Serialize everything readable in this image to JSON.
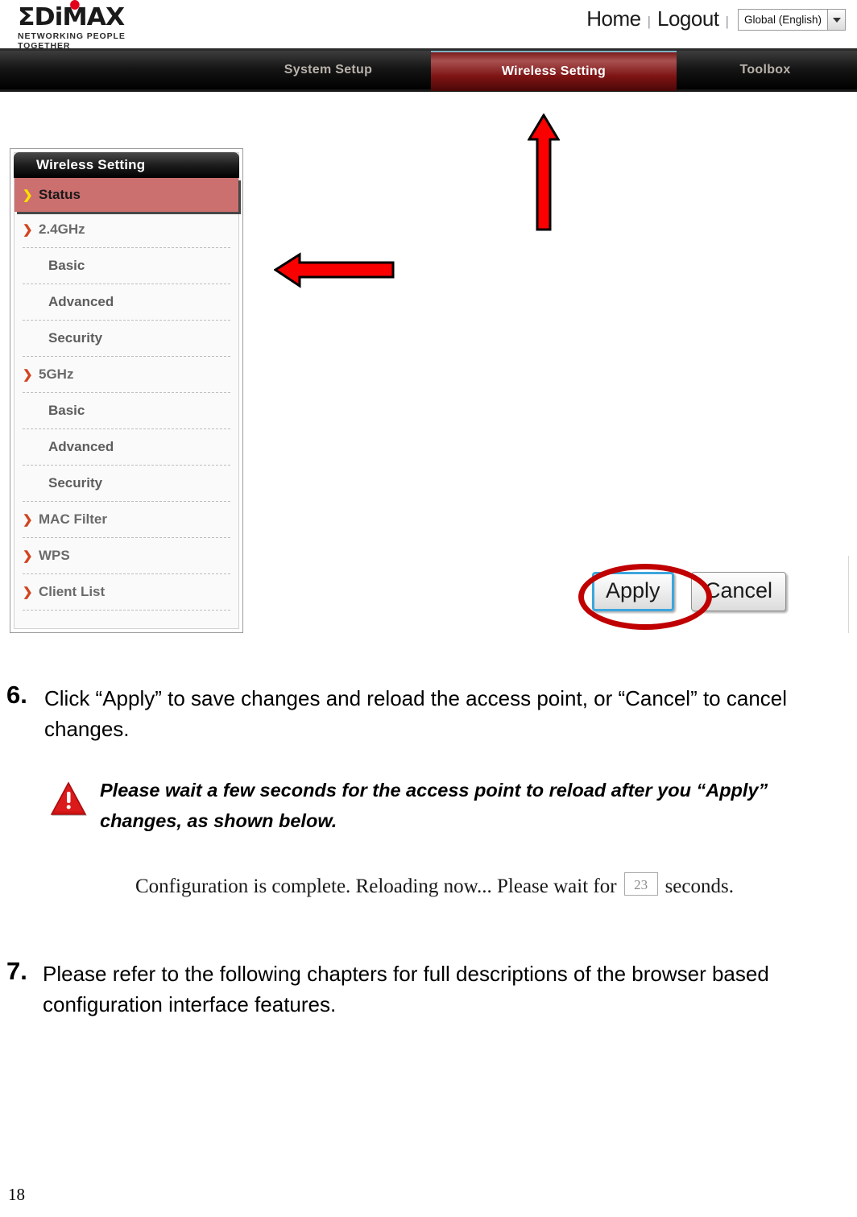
{
  "document": {
    "page_number": "18"
  },
  "router_ui": {
    "logo": {
      "wordmark": "ΣDiMAX",
      "tagline": "NETWORKING PEOPLE TOGETHER"
    },
    "header": {
      "home_label": "Home",
      "separator": "|",
      "logout_label": "Logout",
      "language_value": "Global (English)"
    },
    "nav_tabs": [
      {
        "label": "System Setup",
        "active": false
      },
      {
        "label": "Wireless Setting",
        "active": true
      },
      {
        "label": "Toolbox",
        "active": false
      }
    ],
    "sidebar": {
      "title": "Wireless Setting",
      "items": [
        {
          "label": "Status",
          "level": "top",
          "active": true
        },
        {
          "label": "2.4GHz",
          "level": "top",
          "active": false
        },
        {
          "label": "Basic",
          "level": "sub",
          "active": false
        },
        {
          "label": "Advanced",
          "level": "sub",
          "active": false
        },
        {
          "label": "Security",
          "level": "sub",
          "active": false
        },
        {
          "label": "5GHz",
          "level": "top",
          "active": false
        },
        {
          "label": "Basic",
          "level": "sub",
          "active": false
        },
        {
          "label": "Advanced",
          "level": "sub",
          "active": false
        },
        {
          "label": "Security",
          "level": "sub",
          "active": false
        },
        {
          "label": "MAC Filter",
          "level": "top",
          "active": false
        },
        {
          "label": "WPS",
          "level": "top",
          "active": false
        },
        {
          "label": "Client List",
          "level": "top",
          "active": false
        }
      ]
    },
    "buttons": {
      "apply_label": "Apply",
      "cancel_label": "Cancel"
    },
    "reload_message": {
      "prefix": "Configuration is complete. Reloading now... Please wait for",
      "seconds_value": "23",
      "suffix": "seconds."
    }
  },
  "steps": [
    {
      "number": "6.",
      "text": "Click “Apply” to save changes and reload the access point, or “Cancel” to cancel changes."
    },
    {
      "number": "7.",
      "text": "Please refer to the following chapters for full descriptions of the browser based configuration interface features."
    }
  ],
  "note": {
    "text": "Please wait a few seconds for the access point to reload after you “Apply” changes, as shown below."
  },
  "colors": {
    "accent_red": "#c00000",
    "brand_red": "#e2001a",
    "active_menu": "#cc6f6f",
    "tab_active": "#7e1414",
    "focus_blue": "#3ba6dd"
  }
}
